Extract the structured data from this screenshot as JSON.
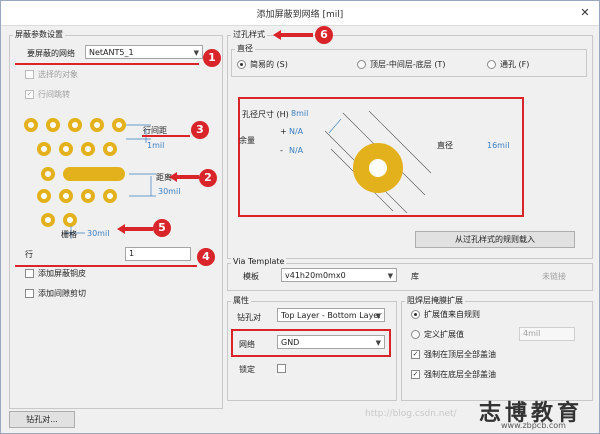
{
  "window": {
    "title": "添加屏蔽到网络 [mil]",
    "close_glyph": "✕"
  },
  "left_panel": {
    "group_title": "屏蔽参数设置",
    "net_label": "要屏蔽的网络",
    "net_value": "NetANT5_1",
    "selected_objects_label": "选择的对象",
    "row_stagger_label": "行间跳转",
    "row_spacing_label": "行间距",
    "row_spacing_value": "1mil",
    "distance_label": "距离",
    "distance_value": "30mil",
    "grid_label": "栅格",
    "grid_value": "30mil",
    "rows_label": "行",
    "rows_value": "1",
    "add_shield_copper_label": "添加屏蔽铜皮",
    "add_gap_cut_label": "添加间隙剪切"
  },
  "via_style": {
    "group_title": "过孔样式",
    "diameter_group": "直径",
    "radio_simple": "简易的 (S)",
    "radio_top_mid_bottom": "顶层-中间层-底层 (T)",
    "radio_full": "通孔 (F)",
    "hole_size_label": "孔径尺寸 (H)",
    "hole_size_value": "8mil",
    "tolerance_label": "余量",
    "tol_plus_sign": "+",
    "tol_plus_value": "N/A",
    "tol_minus_sign": "-",
    "tol_minus_value": "N/A",
    "diameter_label": "直径",
    "diameter_value": "16mil",
    "load_from_rules_button": "从过孔样式的规则载入"
  },
  "via_template": {
    "group_title": "Via Template",
    "template_label": "模板",
    "template_value": "v41h20m0mx0",
    "library_label": "库",
    "library_value": "未链接"
  },
  "properties": {
    "group_title": "属性",
    "drill_pair_label": "钻孔对",
    "drill_pair_value": "Top Layer - Bottom Layer",
    "net_label": "网络",
    "net_value": "GND",
    "locked_label": "锁定"
  },
  "solder_mask": {
    "group_title": "阻焊层掩膜扩展",
    "radio_from_rule": "扩展值来自规则",
    "radio_manual": "定义扩展值",
    "manual_value": "4mil",
    "force_top_tent": "强制在顶层全部盖油",
    "force_bottom_tent": "强制在底层全部盖油"
  },
  "footer": {
    "drill_pairs_button": "钻孔对..."
  },
  "annotations": {
    "n1": "1",
    "n2": "2",
    "n3": "3",
    "n4": "4",
    "n5": "5",
    "n6": "6"
  },
  "watermark": {
    "url": "http://blog.csdn.net/",
    "site": "www.zbpcb.com",
    "logo": "志博教育"
  },
  "colors": {
    "pad_gold": "#e3b11b",
    "annotation_red": "#d9242a",
    "value_blue": "#3a7fc1"
  }
}
